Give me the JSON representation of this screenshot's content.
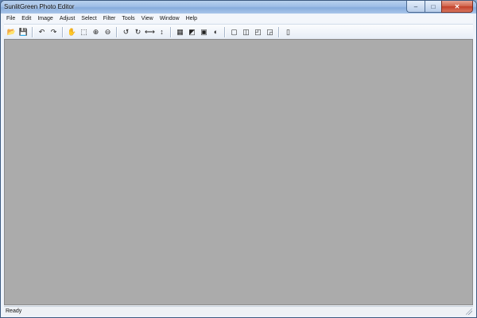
{
  "window": {
    "title": "SunlitGreen Photo Editor"
  },
  "caption_buttons": {
    "minimize": "‒",
    "maximize": "□",
    "close": "✕"
  },
  "menu": [
    "File",
    "Edit",
    "Image",
    "Adjust",
    "Select",
    "Filter",
    "Tools",
    "View",
    "Window",
    "Help"
  ],
  "toolbar": [
    {
      "name": "open-icon",
      "glyph": "📂"
    },
    {
      "name": "save-icon",
      "glyph": "💾"
    },
    {
      "sep": true
    },
    {
      "name": "undo-icon",
      "glyph": "↶"
    },
    {
      "name": "redo-icon",
      "glyph": "↷"
    },
    {
      "sep": true
    },
    {
      "name": "hand-tool-icon",
      "glyph": "✋"
    },
    {
      "name": "rect-select-icon",
      "glyph": "⬚"
    },
    {
      "name": "zoom-in-icon",
      "glyph": "⊕"
    },
    {
      "name": "zoom-out-icon",
      "glyph": "⊖"
    },
    {
      "sep": true
    },
    {
      "name": "rotate-left-icon",
      "glyph": "↺"
    },
    {
      "name": "rotate-right-icon",
      "glyph": "↻"
    },
    {
      "name": "flip-horizontal-icon",
      "glyph": "⟷"
    },
    {
      "name": "flip-vertical-icon",
      "glyph": "↕"
    },
    {
      "sep": true
    },
    {
      "name": "levels-icon",
      "glyph": "▦"
    },
    {
      "name": "curves-icon",
      "glyph": "◩"
    },
    {
      "name": "color-balance-icon",
      "glyph": "▣"
    },
    {
      "name": "brightness-icon",
      "glyph": "◐"
    },
    {
      "sep": true
    },
    {
      "name": "frame-1-icon",
      "glyph": "▢"
    },
    {
      "name": "frame-2-icon",
      "glyph": "◫"
    },
    {
      "name": "frame-3-icon",
      "glyph": "◰"
    },
    {
      "name": "frame-4-icon",
      "glyph": "◲"
    },
    {
      "sep": true
    },
    {
      "name": "film-icon",
      "glyph": "▯"
    }
  ],
  "status": {
    "text": "Ready"
  },
  "colors": {
    "workspace": "#ababab",
    "titlebar": "#9dbde6",
    "close_button": "#c24029"
  }
}
